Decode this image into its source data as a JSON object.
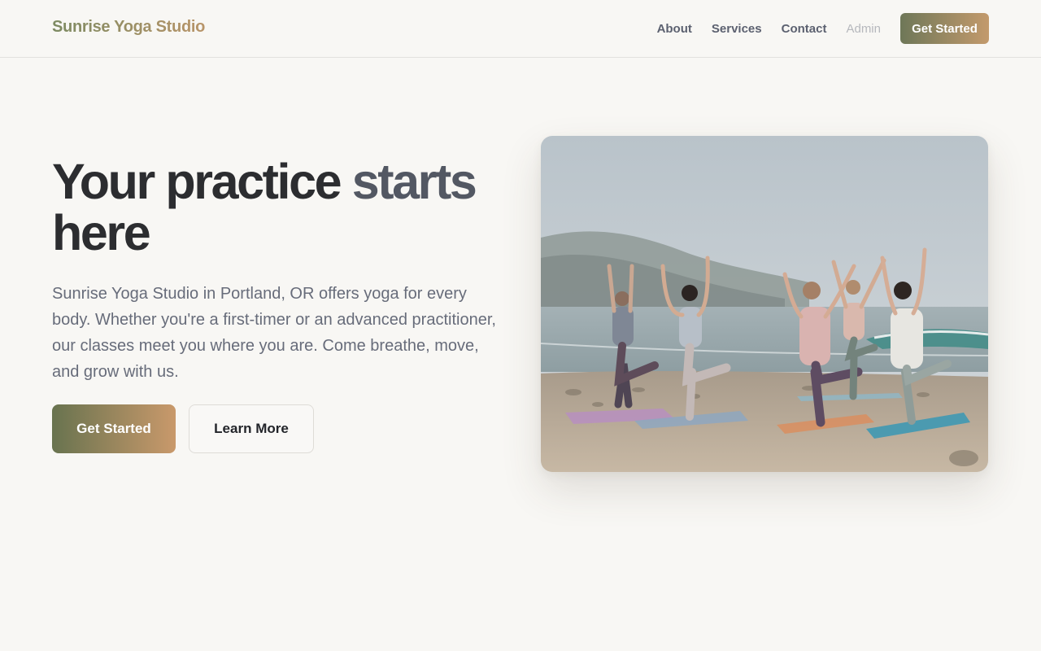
{
  "header": {
    "brand": "Sunrise Yoga Studio",
    "nav": {
      "about": "About",
      "services": "Services",
      "contact": "Contact",
      "admin": "Admin",
      "cta": "Get Started"
    }
  },
  "hero": {
    "headline_line1_main": "Your practice ",
    "headline_line1_accent": "starts",
    "headline_line2": "here",
    "lead": "Sunrise Yoga Studio in Portland, OR offers yoga for every body. Whether you're a first-timer or an advanced practitioner, our classes meet you where you are. Come breathe, move, and grow with us.",
    "primary_button": "Get Started",
    "secondary_button": "Learn More"
  },
  "colors": {
    "background": "#f8f7f4",
    "brand_gradient_start": "#6e7758",
    "brand_gradient_end": "#c39a6c",
    "nav_text": "#5c6170",
    "nav_muted": "#b6b8bd"
  }
}
